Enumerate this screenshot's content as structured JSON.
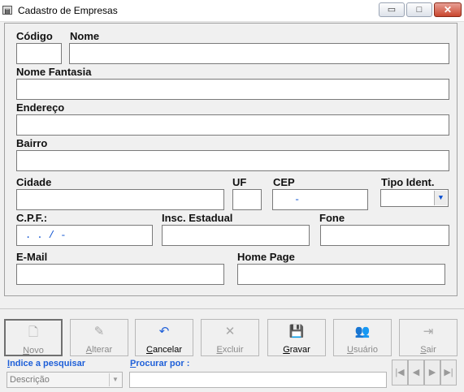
{
  "window": {
    "title": "Cadastro de Empresas",
    "app_icon": "form-app-icon",
    "minimize_glyph": "▭",
    "maximize_glyph": "□",
    "close_glyph": "✕"
  },
  "form": {
    "codigo_label": "Código",
    "nome_label": "Nome",
    "nome_fantasia_label": "Nome Fantasia",
    "endereco_label": "Endereço",
    "bairro_label": "Bairro",
    "cidade_label": "Cidade",
    "uf_label": "UF",
    "cep_label": "CEP",
    "cep_mask": "-",
    "tipo_ident_label": "Tipo Ident.",
    "cpf_label": "C.P.F.:",
    "cpf_mask": ". . /  -",
    "insc_estadual_label": "Insc. Estadual",
    "fone_label": "Fone",
    "email_label": "E-Mail",
    "home_page_label": "Home Page"
  },
  "toolbar": {
    "buttons": [
      {
        "label_u": "N",
        "label_rest": "ovo",
        "icon": "new-document-icon",
        "glyph": "🗋",
        "enabled": false
      },
      {
        "label_u": "A",
        "label_rest": "lterar",
        "icon": "edit-icon",
        "glyph": "✎",
        "enabled": false
      },
      {
        "label_u": "C",
        "label_rest": "ancelar",
        "icon": "undo-icon",
        "glyph": "↶",
        "enabled": true
      },
      {
        "label_u": "E",
        "label_rest": "xcluir",
        "icon": "delete-icon",
        "glyph": "✕",
        "enabled": false
      },
      {
        "label_u": "G",
        "label_rest": "ravar",
        "icon": "save-icon",
        "glyph": "💾",
        "enabled": true
      },
      {
        "label_u": "U",
        "label_rest": "suário",
        "icon": "users-icon",
        "glyph": "👥",
        "enabled": false
      },
      {
        "label_u": "S",
        "label_rest": "air",
        "icon": "exit-door-icon",
        "glyph": "⇥",
        "enabled": false
      }
    ]
  },
  "search": {
    "indice_u": "I",
    "indice_rest": "ndice a pesquisar",
    "indice_value": "Descrição",
    "procurar_u": "P",
    "procurar_rest": "rocurar por :"
  },
  "navigation": {
    "first": "|◀",
    "prev": "◀",
    "next": "▶",
    "last": "▶|"
  }
}
